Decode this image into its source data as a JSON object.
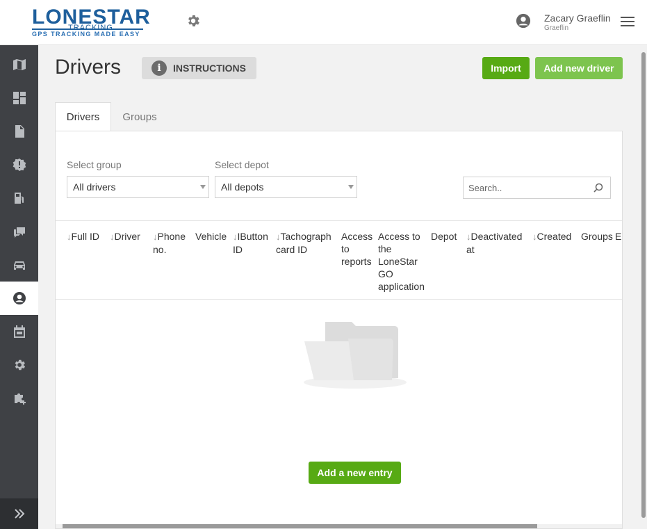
{
  "header": {
    "logo": {
      "brand": "LONESTAR",
      "sub": "TRACKING",
      "tagline": "GPS TRACKING MADE EASY"
    },
    "user": {
      "name": "Zacary Graeflin",
      "subtitle": "Graeflin"
    }
  },
  "sidebar": {
    "items": [
      {
        "icon": "map-icon"
      },
      {
        "icon": "dashboard-icon"
      },
      {
        "icon": "document-icon"
      },
      {
        "icon": "alert-badge-icon"
      },
      {
        "icon": "fuel-icon"
      },
      {
        "icon": "chat-icon"
      },
      {
        "icon": "car-icon"
      },
      {
        "icon": "user-circle-icon",
        "active": true
      },
      {
        "icon": "calendar-icon"
      },
      {
        "icon": "gear-icon"
      },
      {
        "icon": "puzzle-add-icon"
      }
    ],
    "expand_icon": "double-chevron-right-icon"
  },
  "page": {
    "title": "Drivers",
    "instructions_label": "INSTRUCTIONS",
    "import_label": "Import",
    "add_driver_label": "Add new driver"
  },
  "tabs": [
    {
      "label": "Drivers",
      "active": true
    },
    {
      "label": "Groups",
      "active": false
    }
  ],
  "filters": {
    "group_label": "Select group",
    "group_value": "All drivers",
    "depot_label": "Select depot",
    "depot_value": "All depots",
    "search_placeholder": "Search.."
  },
  "table": {
    "columns": [
      {
        "label": "Full ID",
        "sortable": true
      },
      {
        "label": "Driver",
        "sortable": true
      },
      {
        "label": "Phone no.",
        "sortable": true
      },
      {
        "label": "Vehicle",
        "sortable": false
      },
      {
        "label": "IButton ID",
        "sortable": true
      },
      {
        "label": "Tachograph card ID",
        "sortable": true
      },
      {
        "label": "Access to reports",
        "sortable": false
      },
      {
        "label": "Access to the LoneStar GO application",
        "sortable": false
      },
      {
        "label": "Depot",
        "sortable": false
      },
      {
        "label": "Deactivated at",
        "sortable": true
      },
      {
        "label": "Created",
        "sortable": true
      },
      {
        "label": "Groups",
        "sortable": false
      },
      {
        "label": "E",
        "sortable": false
      }
    ],
    "empty_icon": "empty-folder-icon",
    "add_entry_label": "Add a new entry"
  },
  "colors": {
    "accent_green": "#57aa14",
    "accent_green_light": "#7dc44e",
    "brand_blue": "#1e5f9c",
    "sidebar_bg": "#3f4145"
  }
}
